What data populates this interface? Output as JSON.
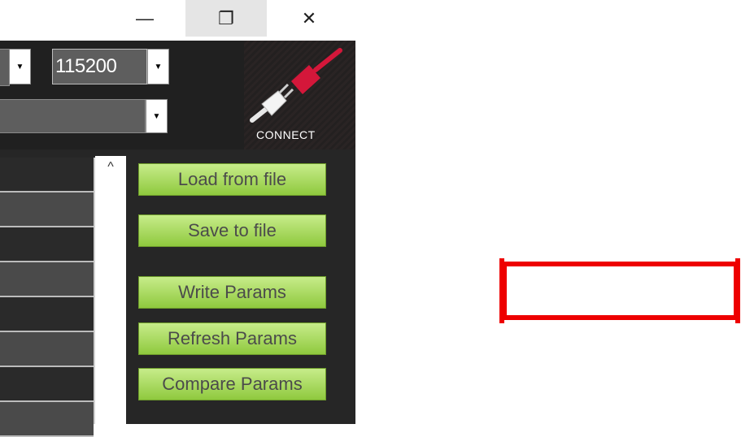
{
  "window": {
    "minimize_glyph": "—",
    "maximize_glyph": "❐",
    "close_glyph": "✕"
  },
  "toolbar": {
    "baud_rate": "115200",
    "dropdown_glyph": "▼",
    "connect_label": "CONNECT"
  },
  "params": {
    "scroll_up_glyph": "^",
    "buttons": {
      "load_from_file": "Load from file",
      "save_to_file": "Save to file",
      "write_params": "Write Params",
      "refresh_params": "Refresh Params",
      "compare_params": "Compare Params"
    }
  },
  "colors": {
    "button_green": "#a8d85c",
    "highlight_red": "#ee0000",
    "plug_red": "#d4173a"
  }
}
